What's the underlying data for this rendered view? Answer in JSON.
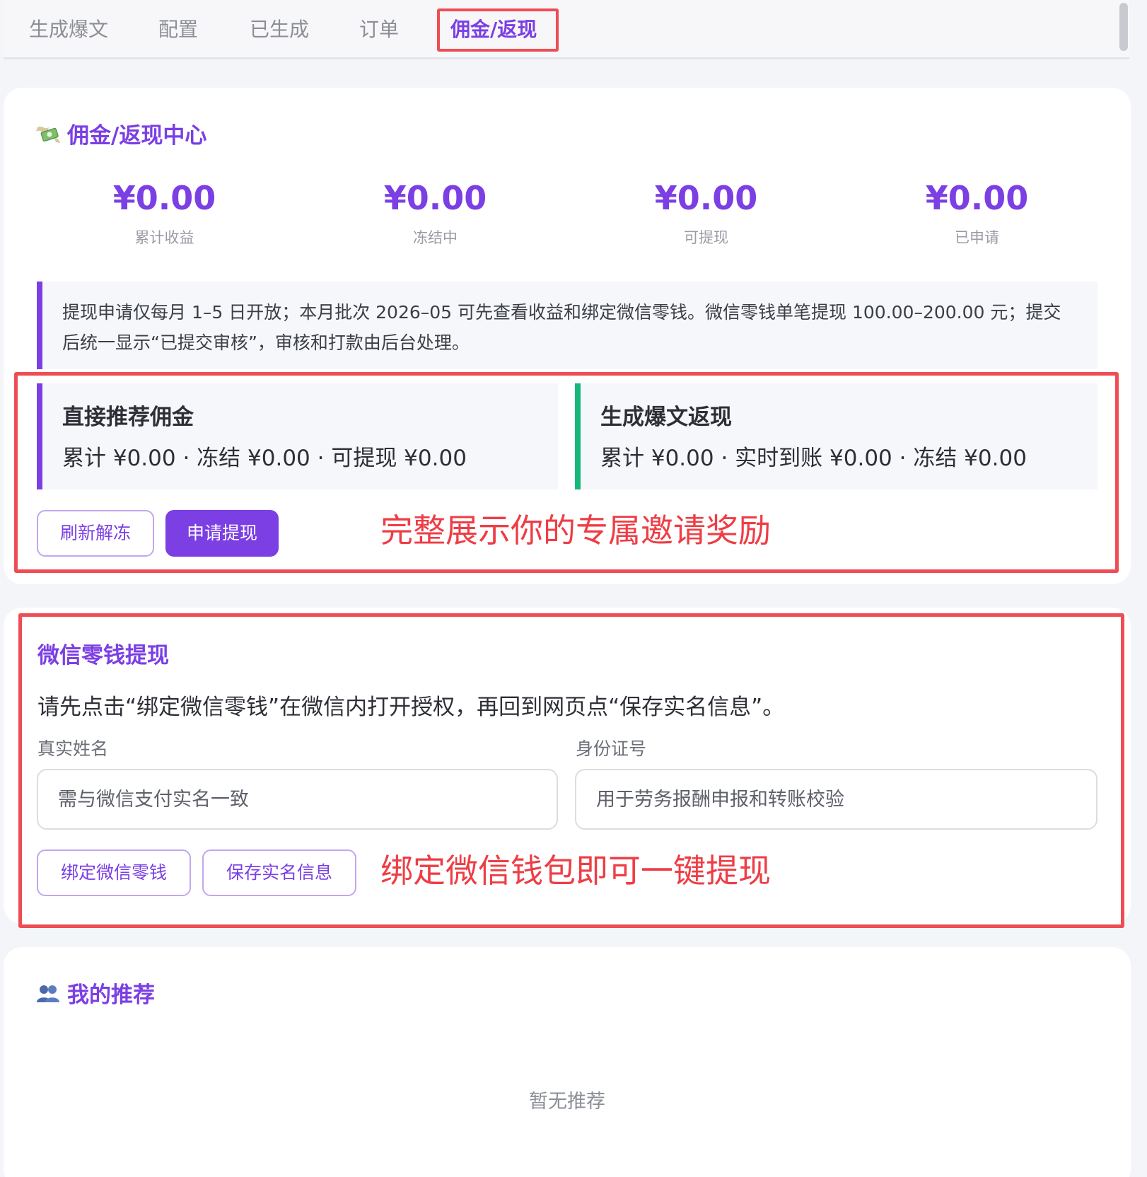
{
  "tabs": [
    {
      "label": "生成爆文",
      "active": false
    },
    {
      "label": "配置",
      "active": false
    },
    {
      "label": "已生成",
      "active": false
    },
    {
      "label": "订单",
      "active": false
    },
    {
      "label": "佣金/返现",
      "active": true
    }
  ],
  "commission": {
    "title": "佣金/返现中心",
    "title_icon": "money-wings-icon",
    "stats": [
      {
        "value": "¥0.00",
        "label": "累计收益"
      },
      {
        "value": "¥0.00",
        "label": "冻结中"
      },
      {
        "value": "¥0.00",
        "label": "可提现"
      },
      {
        "value": "¥0.00",
        "label": "已申请"
      }
    ],
    "notice": "提现申请仅每月 1–5 日开放；本月批次 2026–05 可先查看收益和绑定微信零钱。微信零钱单笔提现 100.00–200.00 元；提交后统一显示“已提交审核”，审核和打款由后台处理。",
    "panels": [
      {
        "title": "直接推荐佣金",
        "line": "累计 ¥0.00 · 冻结 ¥0.00 · 可提现 ¥0.00",
        "accent": "#7b3fe4"
      },
      {
        "title": "生成爆文返现",
        "line": "累计 ¥0.00 · 实时到账 ¥0.00 · 冻结 ¥0.00",
        "accent": "#16b77a"
      }
    ],
    "refresh_button": "刷新解冻",
    "apply_button": "申请提现",
    "annotation": "完整展示你的专属邀请奖励"
  },
  "withdraw": {
    "title": "微信零钱提现",
    "description": "请先点击“绑定微信零钱”在微信内打开授权，再回到网页点“保存实名信息”。",
    "name_label": "真实姓名",
    "name_placeholder": "需与微信支付实名一致",
    "id_label": "身份证号",
    "id_placeholder": "用于劳务报酬申报和转账校验",
    "bind_button": "绑定微信零钱",
    "save_button": "保存实名信息",
    "annotation": "绑定微信钱包即可一键提现"
  },
  "referrals": {
    "title": "我的推荐",
    "title_icon": "users-icon",
    "empty_text": "暂无推荐"
  },
  "colors": {
    "accent": "#7b3fe4",
    "green": "#16b77a",
    "highlight_red": "#ee4d55"
  }
}
